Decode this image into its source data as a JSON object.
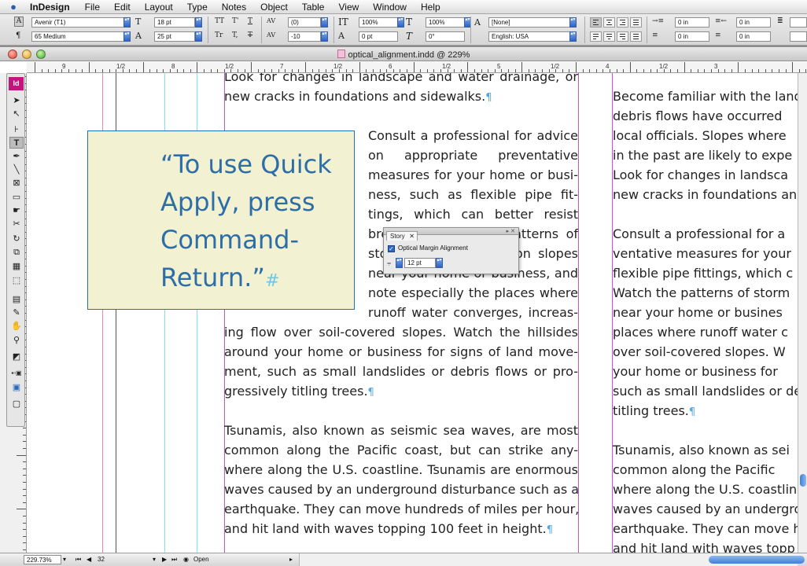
{
  "app": {
    "name": "InDesign",
    "menus": [
      "File",
      "Edit",
      "Layout",
      "Type",
      "Notes",
      "Object",
      "Table",
      "View",
      "Window",
      "Help"
    ]
  },
  "control_panel": {
    "font_family": "Avenir (T1)",
    "font_style": "65 Medium",
    "font_size": "18 pt",
    "leading": "25 pt",
    "kerning": "(0)",
    "tracking": "-10",
    "vertical_scale": "100%",
    "horizontal_scale": "100%",
    "baseline_shift": "0 pt",
    "skew": "0°",
    "char_style": "[None]",
    "language": "English: USA",
    "indent_values": [
      "0 in",
      "0 in",
      "0 in",
      "0 in"
    ],
    "type_glyphs": [
      "TT",
      "T'",
      "T",
      "Tr",
      "T,",
      "T"
    ]
  },
  "document": {
    "title": "optical_alignment.indd @ 229%",
    "ruler_labels": [
      "9",
      "1/2",
      "8",
      "1/2",
      "7",
      "1/2",
      "6",
      "1/2",
      "5",
      "1/2",
      "4",
      "1/2",
      "3"
    ]
  },
  "pull_quote": {
    "lines": [
      "“To use Quick",
      "Apply, press",
      "Command-",
      "Return.”"
    ],
    "end_mark": "#"
  },
  "pilcrow": "¶",
  "columns": {
    "main_top": [
      "Look for changes in landscape and water drainage, or",
      "new cracks in foundations and sidewalks."
    ],
    "main_side": [
      "Consult a professional for advice",
      "on appropriate preventative",
      "measures for your home or busi-",
      "ness, such as flexible pipe fit-",
      "tings, which can better resist",
      "breakage.Watch the patterns of",
      "storm-water drainage on slopes",
      "near your home or business, and",
      "note especially the places where",
      "runoff water converges, increas-"
    ],
    "main_full": [
      "ing flow over soil-covered slopes. Watch the hillsides",
      "around your home or business for signs of land move-",
      "ment, such as small landslides or debris flows or pro-",
      "gressively titling trees."
    ],
    "main_tsunami": [
      "Tsunamis, also known as seismic sea waves, are most",
      "common along the Pacific coast, but can strike any-",
      "where along the U.S. coastline. Tsunamis are enormous",
      "waves caused by an underground disturbance such as an",
      "earthquake. They can move hundreds of miles per hour,",
      "and hit land with waves topping 100 feet in height."
    ],
    "right": [
      "Become familiar with the land",
      "debris flows have occurred",
      "local officials. Slopes where",
      "in the past are likely to expe",
      "Look for changes in landsca",
      "new cracks in foundations an",
      "",
      "Consult a professional for a",
      "ventative measures for your",
      "flexible pipe fittings, which c",
      "Watch the patterns of storm",
      "near your home or busines",
      "places where runoff water c",
      "over soil-covered slopes. W",
      "your home or business for",
      "such as small landslides or de",
      "titling trees.",
      "",
      "Tsunamis, also known as sei",
      "common along the Pacific",
      "where along the U.S. coastlin",
      "waves caused by an undergro",
      "earthquake. They can move h",
      "and hit land with waves topp"
    ]
  },
  "story_panel": {
    "tab": "Story",
    "checkbox_label": "Optical Margin Alignment",
    "checked": true,
    "size": "12 pt"
  },
  "status_bar": {
    "zoom": "229.73%",
    "page": "32",
    "state": "Open"
  },
  "colors": {
    "pull_quote_fill": "#f2f1d1",
    "pull_quote_text": "#2d6ea8",
    "frame_blue": "#1e6fb6",
    "guide_cyan": "#7fe6ee",
    "guide_magenta": "#c84fe0",
    "guide_red": "#e98aa8",
    "indesign_pink": "#c4157d"
  }
}
